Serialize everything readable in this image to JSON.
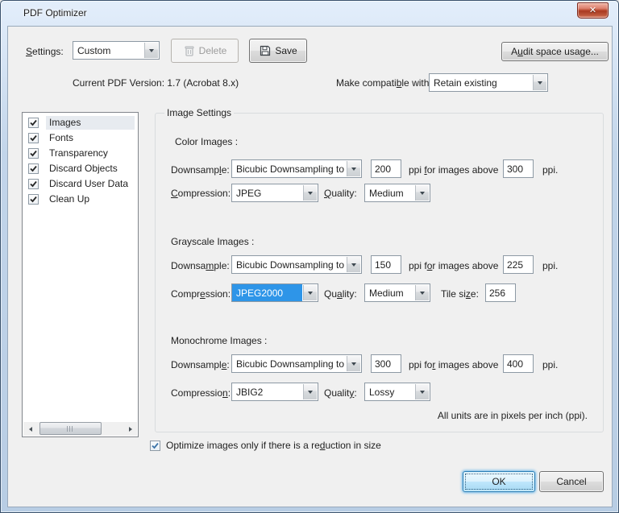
{
  "colors": {
    "selection_blue": "#2e95e8",
    "client_bg": "#f0f0f0",
    "titlebar_top": "#e3eefb",
    "close_red": "#b8462c",
    "ok_focus_border": "#2c7fb6"
  },
  "window": {
    "title": "PDF Optimizer",
    "close_glyph": "✕"
  },
  "toolbar": {
    "settings_label": {
      "text": "Settings:",
      "ul": 0
    },
    "settings_value": "Custom",
    "delete_label": "Delete",
    "save_label": "Save",
    "audit_button": {
      "text": "Audit space usage...",
      "ul": 1
    }
  },
  "version_row": {
    "current_version": "Current PDF Version: 1.7 (Acrobat 8.x)",
    "compat_label": {
      "text": "Make compatible with:",
      "ul": 12
    },
    "compat_value": "Retain existing"
  },
  "panel_list": {
    "items": [
      {
        "label": "Images",
        "checked": true,
        "selected": true
      },
      {
        "label": "Fonts",
        "checked": true,
        "selected": false
      },
      {
        "label": "Transparency",
        "checked": true,
        "selected": false
      },
      {
        "label": "Discard Objects",
        "checked": true,
        "selected": false
      },
      {
        "label": "Discard User Data",
        "checked": true,
        "selected": false
      },
      {
        "label": "Clean Up",
        "checked": true,
        "selected": false
      }
    ]
  },
  "image_settings": {
    "group_title": "Image Settings",
    "sections": [
      {
        "heading": "Color Images :",
        "downsample_label": {
          "text": "Downsample:",
          "ul": 8
        },
        "downsample_value": "Bicubic Downsampling to",
        "ppi_value": "200",
        "above_label": {
          "text": "ppi for images above",
          "ul": 4
        },
        "above_value": "300",
        "ppi_suffix": "ppi.",
        "compression_label": {
          "text": "Compression:",
          "ul": 0
        },
        "compression_value": "JPEG",
        "compression_selected": false,
        "quality_label": {
          "text": "Quality:",
          "ul": 0
        },
        "quality_value": "Medium"
      },
      {
        "heading": "Grayscale Images :",
        "downsample_label": {
          "text": "Downsample:",
          "ul": 6
        },
        "downsample_value": "Bicubic Downsampling to",
        "ppi_value": "150",
        "above_label": {
          "text": "ppi for images above",
          "ul": 5
        },
        "above_value": "225",
        "ppi_suffix": "ppi.",
        "compression_label": {
          "text": "Compression:",
          "ul": 5
        },
        "compression_value": "JPEG2000",
        "compression_selected": true,
        "quality_label": {
          "text": "Quality:",
          "ul": 2
        },
        "quality_value": "Medium",
        "tile_label": {
          "text": "Tile size:",
          "ul": 7
        },
        "tile_value": "256"
      },
      {
        "heading": "Monochrome Images :",
        "downsample_label": {
          "text": "Downsample:",
          "ul": 9
        },
        "downsample_value": "Bicubic Downsampling to",
        "ppi_value": "300",
        "above_label": {
          "text": "ppi for images above",
          "ul": 6
        },
        "above_value": "400",
        "ppi_suffix": "ppi.",
        "compression_label": {
          "text": "Compression:",
          "ul": 10
        },
        "compression_value": "JBIG2",
        "compression_selected": false,
        "quality_label": {
          "text": "Quality:",
          "ul": 6
        },
        "quality_value": "Lossy"
      }
    ],
    "units_note": "All units are in pixels per inch (ppi)."
  },
  "footer": {
    "optimize_label": {
      "text": "Optimize images only if there is a reduction in size",
      "ul": 37
    },
    "optimize_checked": true,
    "ok_label": "OK",
    "cancel_label": "Cancel"
  }
}
